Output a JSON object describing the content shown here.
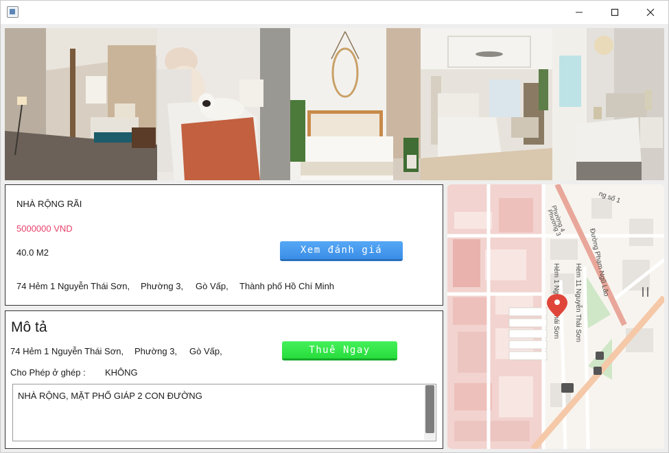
{
  "window": {
    "controls": [
      "minimize",
      "maximize",
      "close"
    ]
  },
  "gallery": {
    "photos": [
      {
        "subject": "long modern bedroom"
      },
      {
        "subject": "bed with plush bear and french bulldog"
      },
      {
        "subject": "white bedroom with round mirror"
      },
      {
        "subject": "bedroom with ceiling fan"
      },
      {
        "subject": "bedroom with chandelier"
      }
    ]
  },
  "listing": {
    "title": "NHÀ RỘNG RÃI",
    "price": "5000000 VND",
    "area": "40.0 M2",
    "review_button": "Xem đánh giá",
    "address": {
      "street": "74 Hẻm 1 Nguyễn Thái Sơn,",
      "ward": "Phường 3,",
      "district": "Gò Vấp,",
      "city": "Thành phố Hồ Chí Minh"
    }
  },
  "description": {
    "heading": "Mô tả",
    "street": "74 Hẻm 1 Nguyễn Thái Sơn,",
    "ward": "Phường 3,",
    "district": "Gò Vấp,",
    "rent_button": "Thuê Ngay",
    "shared_label": "Cho Phép ở ghép :",
    "shared_value": "KHÔNG",
    "details_text": "NHÀ RỘNG, MẶT PHỐ GIÁP 2 CON ĐƯỜNG"
  },
  "map": {
    "labels": {
      "road_top": "ng số 1",
      "ward4": "Phường 4",
      "ward3": "Phường 3",
      "main_road": "Đường Phạm Ngũ Lão",
      "alley11": "Hẻm 11 Nguyễn Thái Sơn",
      "alley1": "Hẻm 1 Nguyễn Thái Sơn"
    },
    "colors": {
      "road": "#e8a79a",
      "block": "#f0c6c2",
      "park": "#cfe7c7"
    }
  }
}
